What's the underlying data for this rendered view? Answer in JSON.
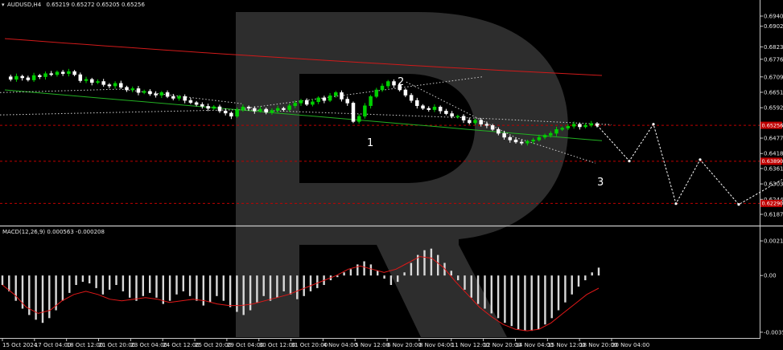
{
  "colors": {
    "background": "#000000",
    "bull_candle": "#00d000",
    "bear_candle": "#ffffff",
    "ma_slow": "#d11a1a",
    "ma_fast": "#22b022",
    "level_line": "#c00000",
    "macd_hist": "#d9d9d9",
    "macd_signal": "#e01818",
    "forecast": "#ffffff",
    "axis_text": "#e6e6e6"
  },
  "chart_data": [
    {
      "type": "candlestick",
      "title": "AUDUSD,H4",
      "ohlc_readout": "0.65219 0.65272 0.65205 0.65256",
      "y_ticks": [
        "0.69405",
        "0.69020",
        "0.68235",
        "0.67765",
        "0.67095",
        "0.66510",
        "0.65925",
        "0.65256",
        "0.64770",
        "0.64185",
        "0.63615",
        "0.63030",
        "0.62445",
        "0.61875"
      ],
      "ylim": [
        0.616,
        0.6965
      ],
      "x_ticks": [
        "15 Oct 2024",
        "17 Oct 04:00",
        "18 Oct 12:00",
        "21 Oct 20:00",
        "23 Oct 04:00",
        "24 Oct 12:00",
        "25 Oct 20:00",
        "29 Oct 04:00",
        "30 Oct 12:00",
        "31 Oct 20:00",
        "4 Nov 04:00",
        "5 Nov 12:00",
        "6 Nov 20:00",
        "8 Nov 04:00",
        "11 Nov 12:00",
        "12 Nov 20:00",
        "14 Nov 04:00",
        "15 Nov 12:00",
        "18 Nov 20:00",
        "20 Nov 04:00"
      ],
      "current_price": 0.65256,
      "levels": [
        {
          "value": 0.65256,
          "tag": "0.65256"
        },
        {
          "value": 0.6389,
          "tag": "0.63890"
        },
        {
          "value": 0.6229,
          "tag": "0.62290"
        }
      ],
      "wave_labels": [
        "1",
        "2",
        "3"
      ],
      "wave_points": [
        {
          "label": "1",
          "price": 0.6476
        },
        {
          "label": "2",
          "price": 0.6695
        },
        {
          "label": "3",
          "price": 0.638
        }
      ],
      "close_path": [
        0.671,
        0.67,
        0.6712,
        0.6706,
        0.6698,
        0.6715,
        0.671,
        0.6722,
        0.6718,
        0.6728,
        0.6722,
        0.673,
        0.6718,
        0.6695,
        0.67,
        0.6688,
        0.6692,
        0.668,
        0.6675,
        0.6685,
        0.667,
        0.666,
        0.6665,
        0.665,
        0.6655,
        0.6645,
        0.664,
        0.665,
        0.6635,
        0.6628,
        0.6635,
        0.662,
        0.6612,
        0.6605,
        0.6598,
        0.659,
        0.6596,
        0.658,
        0.6572,
        0.656,
        0.6585,
        0.6595,
        0.659,
        0.658,
        0.6587,
        0.6575,
        0.6582,
        0.659,
        0.6585,
        0.66,
        0.661,
        0.662,
        0.6605,
        0.6615,
        0.663,
        0.662,
        0.6638,
        0.665,
        0.6625,
        0.661,
        0.654,
        0.656,
        0.66,
        0.6635,
        0.666,
        0.6675,
        0.6692,
        0.6678,
        0.666,
        0.664,
        0.662,
        0.66,
        0.659,
        0.6585,
        0.6595,
        0.658,
        0.657,
        0.656,
        0.656,
        0.6545,
        0.6535,
        0.6545,
        0.653,
        0.6525,
        0.651,
        0.6495,
        0.648,
        0.647,
        0.6462,
        0.6458,
        0.6465,
        0.647,
        0.648,
        0.6488,
        0.6495,
        0.651,
        0.6515,
        0.6522,
        0.653,
        0.652,
        0.6526,
        0.6532,
        0.6526
      ],
      "forecast_path": [
        0.65256,
        0.639,
        0.653,
        0.638,
        0.645,
        0.623,
        0.6395,
        0.635,
        0.623,
        0.632
      ]
    },
    {
      "type": "bar",
      "title": "MACD(12,26,9) 0.000563 -0.000208",
      "y_ticks": [
        "0.002191",
        "0.00",
        "-0.003588"
      ],
      "ylim": [
        -0.0038,
        0.0025
      ],
      "histogram": [
        -0.0006,
        -0.001,
        -0.0016,
        -0.0021,
        -0.0025,
        -0.0028,
        -0.003,
        -0.0027,
        -0.0022,
        -0.0016,
        -0.0011,
        -0.0006,
        -0.0004,
        -0.0005,
        -0.0008,
        -0.0012,
        -0.0009,
        -0.0006,
        -0.001,
        -0.0014,
        -0.0016,
        -0.0013,
        -0.0011,
        -0.0014,
        -0.0018,
        -0.0016,
        -0.0012,
        -0.001,
        -0.0013,
        -0.0016,
        -0.0019,
        -0.0017,
        -0.0013,
        -0.0016,
        -0.002,
        -0.0023,
        -0.0025,
        -0.0022,
        -0.0017,
        -0.0013,
        -0.0016,
        -0.0014,
        -0.001,
        -0.0012,
        -0.0015,
        -0.0013,
        -0.001,
        -0.0008,
        -0.0006,
        -0.0003,
        -0.0001,
        0.0002,
        0.0004,
        0.0007,
        0.0009,
        0.0007,
        0.0003,
        -0.0002,
        -0.0006,
        -0.0004,
        0.0002,
        0.0008,
        0.0013,
        0.0016,
        0.0017,
        0.0013,
        0.0008,
        0.0003,
        -0.0003,
        -0.0009,
        -0.0014,
        -0.0018,
        -0.0021,
        -0.0024,
        -0.0027,
        -0.003,
        -0.0032,
        -0.0034,
        -0.0035,
        -0.0035,
        -0.0034,
        -0.0031,
        -0.0027,
        -0.0022,
        -0.0017,
        -0.0012,
        -0.0007,
        -0.0003,
        0.0002,
        0.0005
      ],
      "signal": [
        -0.0006,
        -0.0012,
        -0.002,
        -0.0024,
        -0.0022,
        -0.0016,
        -0.0012,
        -0.001,
        -0.0012,
        -0.0015,
        -0.0016,
        -0.0015,
        -0.0014,
        -0.0015,
        -0.0017,
        -0.0016,
        -0.0015,
        -0.0016,
        -0.0018,
        -0.0019,
        -0.0019,
        -0.0018,
        -0.0016,
        -0.0014,
        -0.0012,
        -0.0009,
        -0.0006,
        -0.0003,
        0.0,
        0.0004,
        0.0006,
        0.0004,
        0.0002,
        0.0004,
        0.0008,
        0.0012,
        0.0011,
        0.0005,
        -0.0004,
        -0.0012,
        -0.002,
        -0.0026,
        -0.0031,
        -0.0034,
        -0.0035,
        -0.0034,
        -0.003,
        -0.0024,
        -0.0018,
        -0.0012,
        -0.0008
      ]
    }
  ]
}
